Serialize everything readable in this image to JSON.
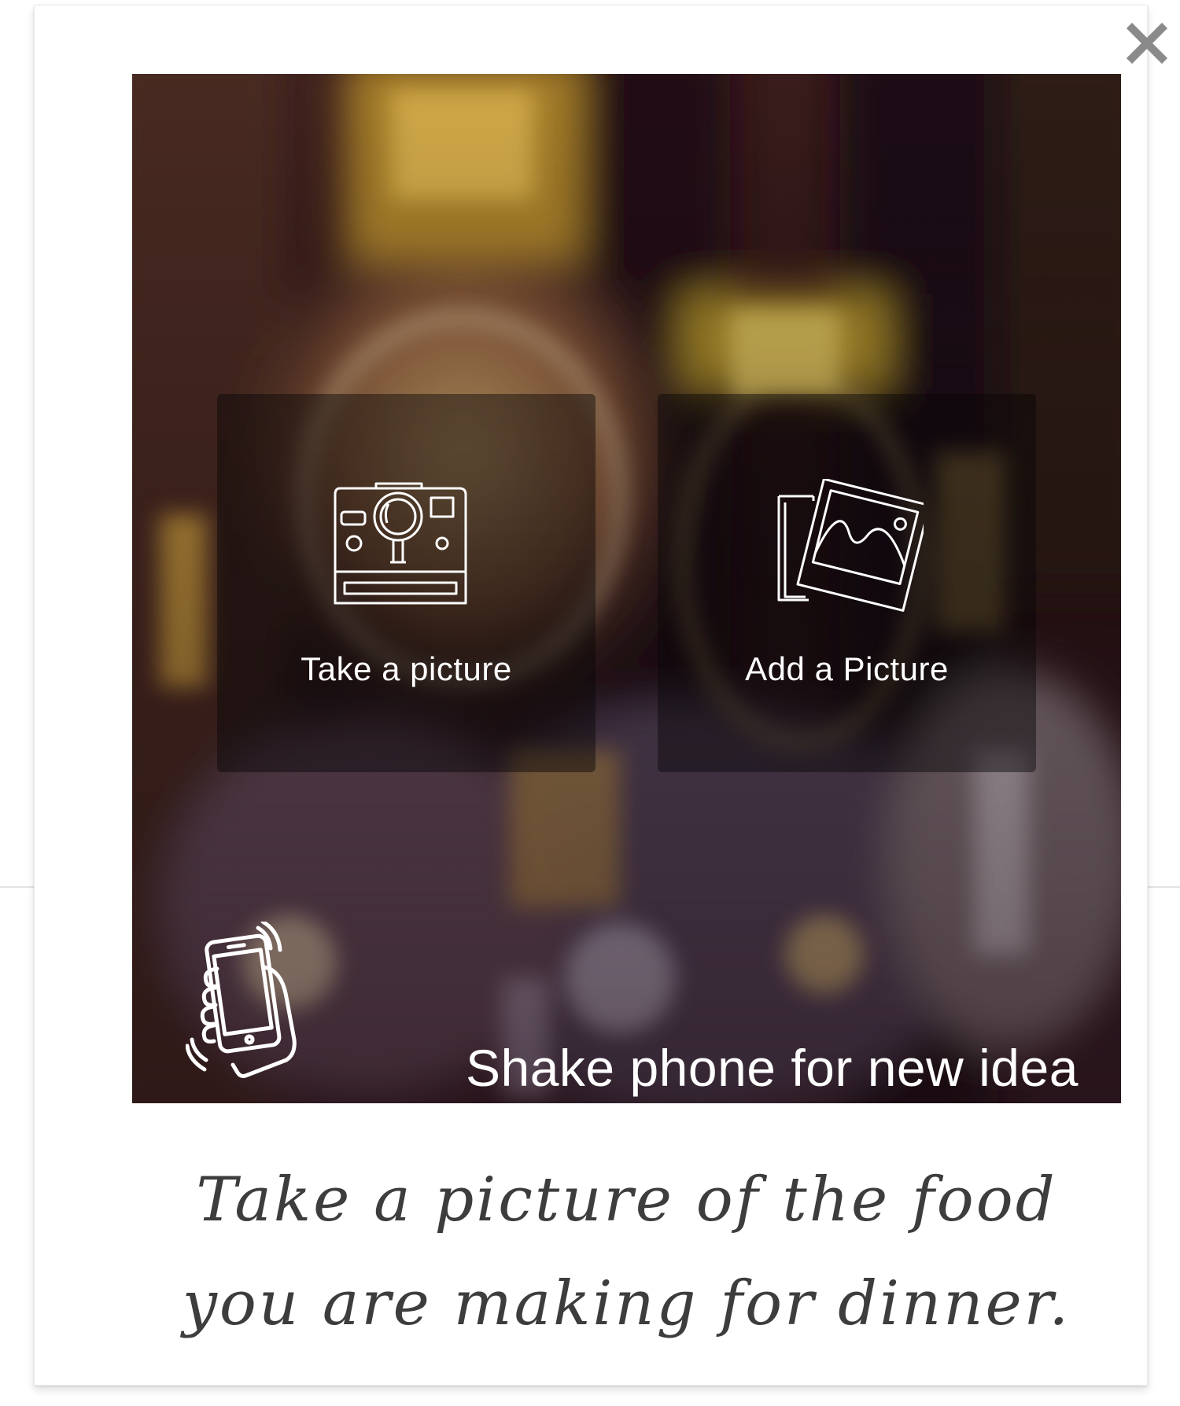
{
  "dialog": {
    "close_icon": "close-x-icon",
    "photo_icon_note": "blurred-background-photo"
  },
  "actions": {
    "take": {
      "label": "Take a picture",
      "icon": "instant-camera-icon"
    },
    "add": {
      "label": "Add a Picture",
      "icon": "photo-stack-icon"
    }
  },
  "hint": {
    "text": "Shake phone for new idea",
    "icon": "shake-phone-icon"
  },
  "caption": {
    "text": "Take a picture of the food you are making for dinner."
  },
  "colors": {
    "caption_text": "#3d3d3d",
    "overlay_text": "#ffffff",
    "close_icon": "#8a8a8a"
  }
}
